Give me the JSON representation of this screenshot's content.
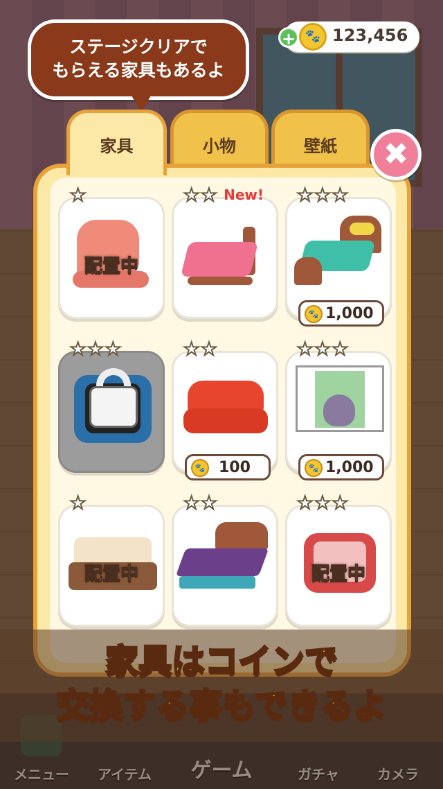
{
  "hint_bubble": {
    "text": "ステージクリアで\nもらえる家具もあるよ"
  },
  "coins": {
    "value": "123,456",
    "add_label": "+"
  },
  "tabs": [
    {
      "label": "家具",
      "active": true
    },
    {
      "label": "小物",
      "active": false
    },
    {
      "label": "壁紙",
      "active": false
    }
  ],
  "close_label": "✖",
  "items": [
    {
      "stars": "★",
      "status": "配置中",
      "art": "pink-chair"
    },
    {
      "stars": "★★",
      "badge": "New!",
      "art": "pink-dotted-bed"
    },
    {
      "stars": "★★★",
      "price": "1,000",
      "art": "green-bed"
    },
    {
      "stars": "★★★",
      "locked": true,
      "art": "blue-tv"
    },
    {
      "stars": "★★",
      "price": "100",
      "art": "red-sofa"
    },
    {
      "stars": "★★★",
      "price": "1,000",
      "art": "cat-window"
    },
    {
      "stars": "★",
      "status": "配置中",
      "art": "brown-sofa"
    },
    {
      "stars": "★★",
      "art": "purple-bed"
    },
    {
      "stars": "★★★",
      "status": "配置中",
      "art": "red-tv"
    }
  ],
  "banner": {
    "text": "家具はコインで\n交換する事もできるよ"
  },
  "bottom_nav": [
    {
      "label": "メニュー"
    },
    {
      "label": "アイテム"
    },
    {
      "label": "ゲーム"
    },
    {
      "label": "ガチャ"
    },
    {
      "label": "カメラ"
    }
  ],
  "colors": {
    "accent": "#e8a23a",
    "panel": "#fde9a7",
    "bubble": "#8a3a1a",
    "close": "#f0809a",
    "banner_text": "#ffd94a"
  }
}
